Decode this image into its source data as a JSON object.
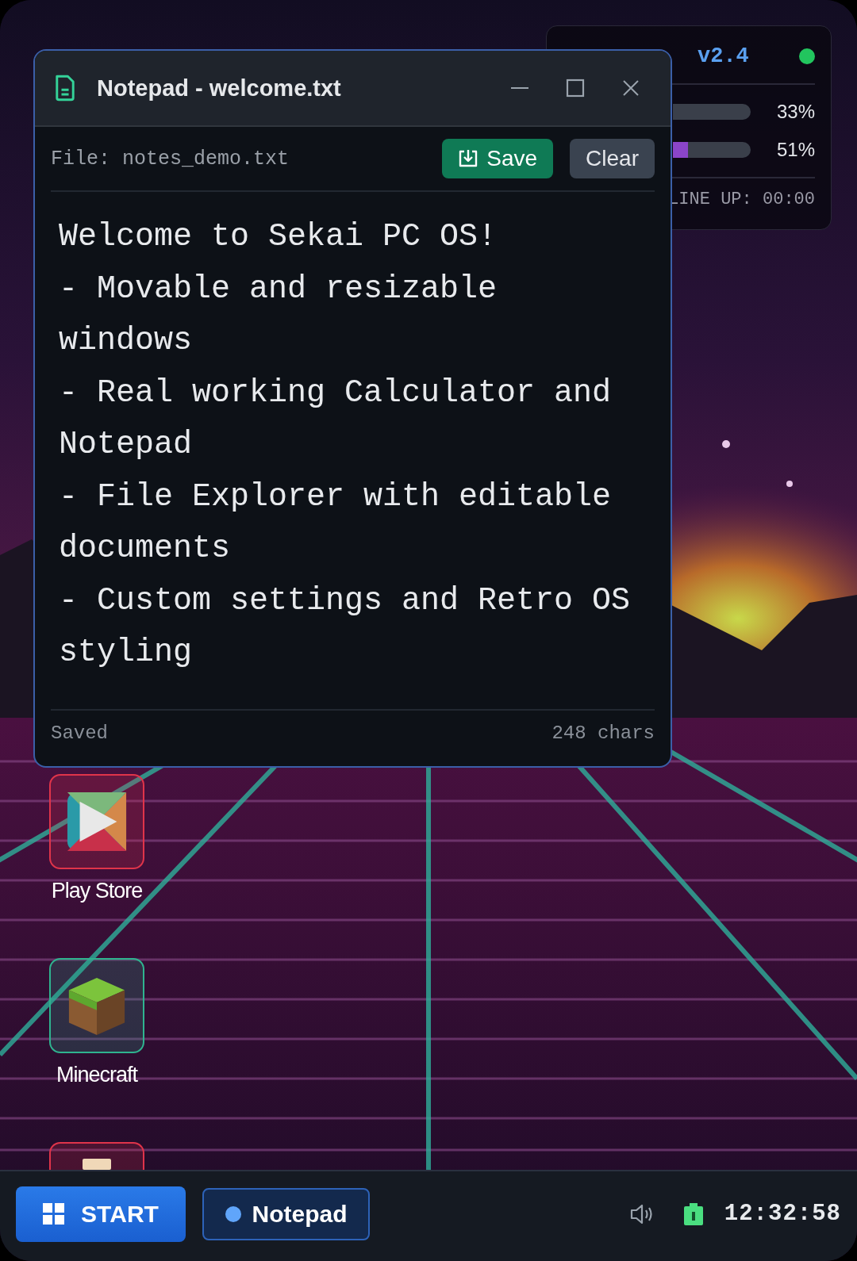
{
  "desktop": {
    "icons": [
      {
        "kind": "play",
        "label": "Play Store",
        "color": "#e0344a"
      },
      {
        "kind": "cube",
        "label": "Minecraft",
        "color": "#2fb38f"
      },
      {
        "kind": "scroll",
        "color": "#e0344a"
      }
    ]
  },
  "status_widget": {
    "title": "v2.4",
    "online": true,
    "meters": [
      {
        "reading": "33%"
      },
      {
        "reading": "51%",
        "color": "#8b45c9"
      }
    ],
    "footer": "LINE UP: 00:00"
  },
  "window": {
    "title": "Notepad - welcome.txt",
    "file_label": "File: notes_demo.txt",
    "buttons": [
      {
        "kind": "save",
        "label": "Save"
      },
      {
        "kind": "clear",
        "label": "Clear"
      }
    ],
    "content": "Welcome to Sekai PC OS!\n- Movable and resizable windows\n- Real working Calculator and Notepad\n- File Explorer with editable documents\n- Custom settings and Retro OS styling",
    "status": "Saved",
    "char_count": "248 chars"
  },
  "taskbar": {
    "start": "START",
    "apps": [
      {
        "label": "Notepad",
        "selected": true
      }
    ],
    "clock": "12:32:58"
  }
}
